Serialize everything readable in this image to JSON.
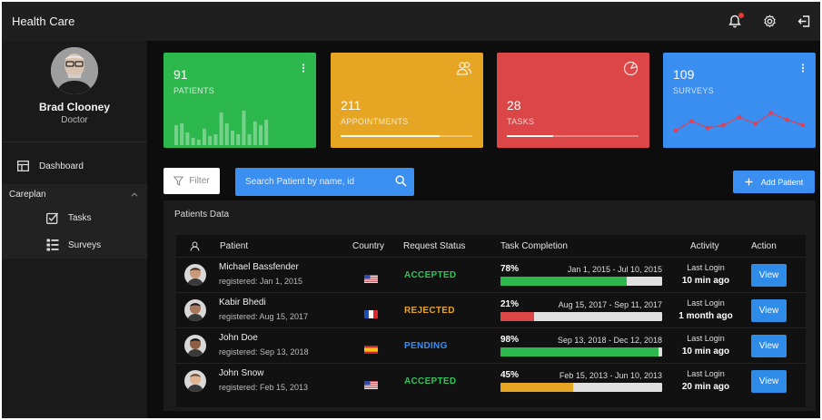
{
  "app": {
    "title": "Health Care"
  },
  "topbar": {
    "icons": [
      "bell-icon",
      "gear-icon",
      "logout-icon"
    ],
    "notification_color": "#e53935"
  },
  "profile": {
    "name": "Brad Clooney",
    "role": "Doctor"
  },
  "nav": {
    "dashboard": "Dashboard",
    "careplan": "Careplan",
    "tasks": "Tasks",
    "surveys": "Surveys"
  },
  "cards": {
    "patients": {
      "value": "91",
      "label": "PATIENTS",
      "color": "#2db84d",
      "bars": [
        0.55,
        0.6,
        0.35,
        0.2,
        0.15,
        0.45,
        0.25,
        0.3,
        0.9,
        0.6,
        0.4,
        0.3,
        0.95,
        0.3,
        0.65,
        0.55,
        0.7
      ]
    },
    "appointments": {
      "value": "211",
      "label": "APPOINTMENTS",
      "color": "#e6a623",
      "progress": 0.75
    },
    "tasks": {
      "value": "28",
      "label": "TASKS",
      "color": "#dc4646",
      "progress": 0.35
    },
    "surveys": {
      "value": "109",
      "label": "SURVEYS",
      "color": "#3a8ef0",
      "trend": [
        0.2,
        0.55,
        0.3,
        0.4,
        0.7,
        0.45,
        0.85,
        0.6,
        0.4
      ]
    }
  },
  "toolbar": {
    "filter_label": "Filter",
    "search_placeholder": "Search Patient by name, id",
    "add_label": "Add Patient"
  },
  "panel": {
    "title": "Patients Data"
  },
  "table": {
    "headers": {
      "patient": "Patient",
      "country": "Country",
      "status": "Request Status",
      "task": "Task Completion",
      "activity": "Activity",
      "action": "Action"
    },
    "rows": [
      {
        "name": "Michael Bassfender",
        "registered": "registered: Jan 1, 2015",
        "country": "us",
        "status": "ACCEPTED",
        "status_color": "#2ec45a",
        "pct": "78%",
        "progress": 0.78,
        "bar_color": "#2db84d",
        "dates": "Jan 1, 2015 - Jul 10, 2015",
        "last": "Last Login",
        "ago": "10 min ago",
        "action": "View"
      },
      {
        "name": "Kabir Bhedi",
        "registered": "registered: Aug 15, 2017",
        "country": "fr",
        "status": "REJECTED",
        "status_color": "#e6a623",
        "pct": "21%",
        "progress": 0.21,
        "bar_color": "#dc4646",
        "dates": "Aug 15, 2017 - Sep 11, 2017",
        "last": "Last Login",
        "ago": "1 month ago",
        "action": "View"
      },
      {
        "name": "John Doe",
        "registered": "registered: Sep 13, 2018",
        "country": "es",
        "status": "PENDING",
        "status_color": "#3a8ef0",
        "pct": "98%",
        "progress": 0.98,
        "bar_color": "#2db84d",
        "dates": "Sep 13, 2018 - Dec 12, 2018",
        "last": "Last Login",
        "ago": "10 min ago",
        "action": "View"
      },
      {
        "name": "John Snow",
        "registered": "registered: Feb 15, 2013",
        "country": "us",
        "status": "ACCEPTED",
        "status_color": "#2ec45a",
        "pct": "45%",
        "progress": 0.45,
        "bar_color": "#e6a623",
        "dates": "Feb 15, 2013 - Jun 10, 2013",
        "last": "Last Login",
        "ago": "20 min ago",
        "action": "View"
      }
    ]
  }
}
